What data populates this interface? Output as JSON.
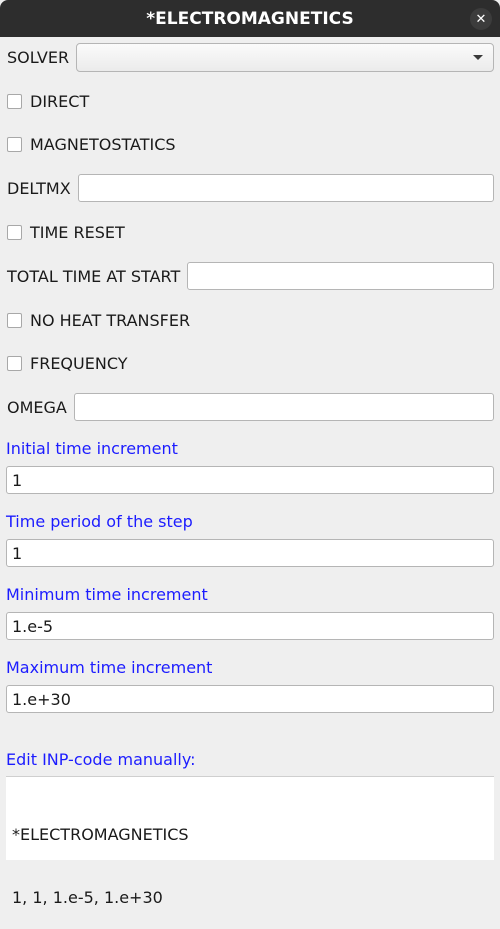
{
  "window": {
    "title": "*ELECTROMAGNETICS",
    "close_symbol": "✕"
  },
  "solver": {
    "label": "SOLVER",
    "value": ""
  },
  "direct": {
    "label": "DIRECT",
    "checked": false
  },
  "magnetostatics": {
    "label": "MAGNETOSTATICS",
    "checked": false
  },
  "deltmx": {
    "label": "DELTMX",
    "value": ""
  },
  "time_reset": {
    "label": "TIME RESET",
    "checked": false
  },
  "total_time_at_start": {
    "label": "TOTAL TIME AT START",
    "value": ""
  },
  "no_heat_transfer": {
    "label": "NO HEAT TRANSFER",
    "checked": false
  },
  "frequency": {
    "label": "FREQUENCY",
    "checked": false
  },
  "omega": {
    "label": "OMEGA",
    "value": ""
  },
  "initial_time_increment": {
    "label": "Initial time increment",
    "value": "1"
  },
  "time_period": {
    "label": "Time period of the step",
    "value": "1"
  },
  "minimum_time_increment": {
    "label": "Minimum time increment",
    "value": "1.e-5"
  },
  "maximum_time_increment": {
    "label": "Maximum time increment",
    "value": "1.e+30"
  },
  "inp_code": {
    "label": "Edit INP-code manually:",
    "lines": [
      "*ELECTROMAGNETICS",
      "1, 1, 1.e-5, 1.e+30"
    ]
  },
  "colors": {
    "titlebar": "#2d2d2d",
    "accent_label": "#1c1cff",
    "background": "#efefef"
  }
}
